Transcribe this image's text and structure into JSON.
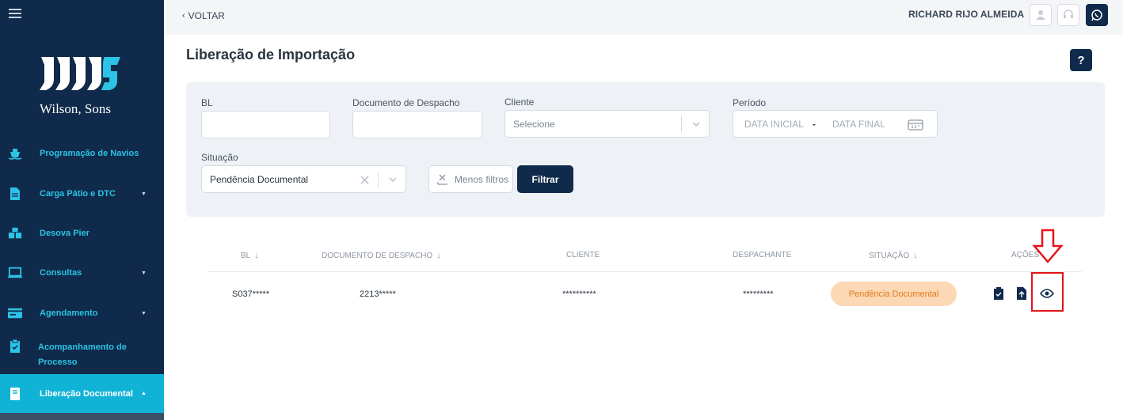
{
  "sidebar": {
    "brand": "Wilson, Sons",
    "items": [
      {
        "label": "Programação de Navios",
        "icon": "ship-icon",
        "has_caret": false
      },
      {
        "label": "Carga Pátio e DTC",
        "icon": "document-icon",
        "has_caret": true
      },
      {
        "label": "Desova Pier",
        "icon": "boxes-icon",
        "has_caret": false
      },
      {
        "label": "Consultas",
        "icon": "monitor-icon",
        "has_caret": true
      },
      {
        "label": "Agendamento",
        "icon": "card-icon",
        "has_caret": true
      },
      {
        "label": "Acompanhamento de Processo",
        "icon": "clipboard-check-icon",
        "has_caret": false
      },
      {
        "label": "Liberação Documental",
        "icon": "book-icon",
        "has_caret": true,
        "active": true
      }
    ]
  },
  "header": {
    "back_label": "VOLTAR",
    "username": "RICHARD RIJO ALMEIDA"
  },
  "page": {
    "title": "Liberação de Importação",
    "help": "?"
  },
  "filters": {
    "bl_label": "BL",
    "bl_value": "",
    "doc_label": "Documento de Despacho",
    "doc_value": "",
    "cliente_label": "Cliente",
    "cliente_placeholder": "Selecione",
    "periodo_label": "Período",
    "data_inicial": "DATA INICIAL",
    "data_separator": "-",
    "data_final": "DATA FINAL",
    "situacao_label": "Situação",
    "situacao_value": "Pendência Documental",
    "less_filters_label": "Menos filtros",
    "filter_button_label": "Filtrar"
  },
  "table": {
    "columns": [
      "BL",
      "DOCUMENTO DE DESPACHO",
      "CLIENTE",
      "DESPACHANTE",
      "SITUAÇÃO",
      "AÇÕES"
    ],
    "rows": [
      {
        "bl": "S037*****",
        "documento": "2213*****",
        "cliente": "**********",
        "despachante": "*********",
        "situacao": "Pendência Documental"
      }
    ]
  },
  "colors": {
    "sidebar_bg": "#0f2a4a",
    "accent": "#10b3d6",
    "nav_text": "#2cc3e6",
    "badge_bg": "#fcd8b4",
    "badge_text": "#e07b1a",
    "highlight": "#e4141b"
  }
}
